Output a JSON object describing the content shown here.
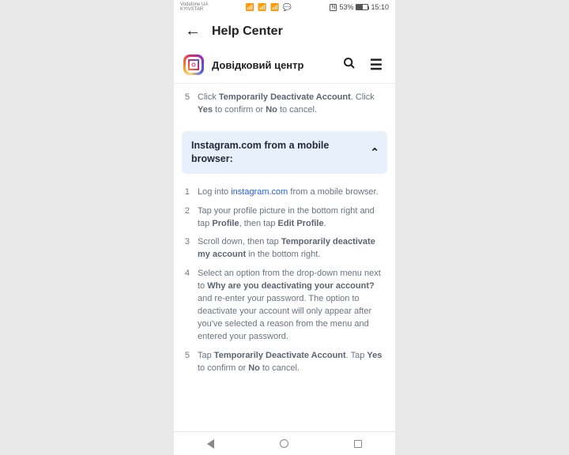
{
  "status": {
    "carrier1": "Vodafone UA",
    "carrier2": "KYIVSTAR",
    "nfc": "N",
    "battery_pct": "53%",
    "time": "15:10"
  },
  "app_header": {
    "title": "Help Center"
  },
  "ig_header": {
    "title": "Довідковий центр"
  },
  "upper_steps": [
    {
      "n": "5",
      "parts": [
        "Click ",
        "Temporarily Deactivate Account",
        ". Click ",
        "Yes",
        " to confirm or ",
        "No",
        " to cancel."
      ]
    }
  ],
  "accordion": {
    "title": "Instagram.com from a mobile browser:"
  },
  "lower_steps": [
    {
      "n": "1",
      "parts": [
        "Log into ",
        {
          "link": "instagram.com"
        },
        " from a mobile browser."
      ]
    },
    {
      "n": "2",
      "parts": [
        "Tap your profile picture in the bottom right and tap ",
        "Profile",
        ", then tap ",
        "Edit Profile",
        "."
      ]
    },
    {
      "n": "3",
      "parts": [
        "Scroll down, then tap ",
        "Temporarily deactivate my account",
        " in the bottom right."
      ]
    },
    {
      "n": "4",
      "parts": [
        "Select an option from the drop-down menu next to ",
        "Why are you deactivating your account?",
        " and re-enter your password. The option to deactivate your account will only appear after you've selected a reason from the menu and entered your password."
      ]
    },
    {
      "n": "5",
      "parts": [
        "Tap ",
        "Temporarily Deactivate Account",
        ". Tap ",
        "Yes",
        " to confirm or ",
        "No",
        " to cancel."
      ]
    }
  ]
}
